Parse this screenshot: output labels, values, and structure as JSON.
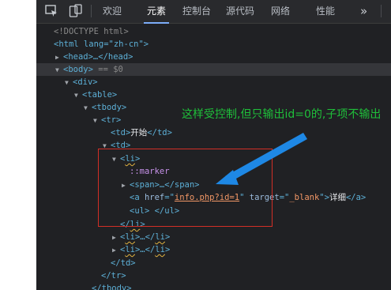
{
  "devtools": {
    "tabs": [
      {
        "label": "欢迎",
        "active": false
      },
      {
        "label": "元素",
        "active": true
      },
      {
        "label": "控制台",
        "active": false
      },
      {
        "label": "源代码",
        "active": false
      },
      {
        "label": "网络",
        "active": false
      },
      {
        "label": "性能",
        "active": false
      }
    ],
    "more": "»",
    "toolbar_icons": [
      "inspect-icon",
      "device-toolbar-icon"
    ]
  },
  "dom": {
    "doctype": "<!DOCTYPE html>",
    "html_open": "<html lang=\"zh-cn\">",
    "head": "<head>…</head>",
    "selected_marker": "== $0",
    "start_text": "开始",
    "marker": "::marker",
    "span_collapsed": "<span>…</span>",
    "href_value": "info.php?id=1",
    "target_value": "_blank",
    "link_text": "详细"
  },
  "annotation": {
    "text": "这样受控制,但只输出id=0的,子项不输出",
    "colors": {
      "text": "#1fbf3a",
      "box": "#d22f26",
      "arrow": "#1e88e5"
    }
  }
}
